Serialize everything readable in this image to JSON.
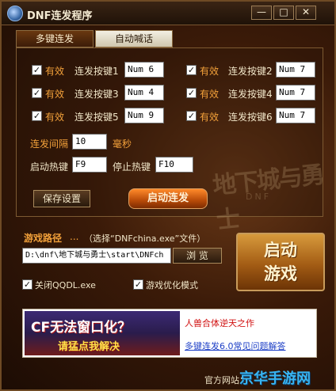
{
  "window": {
    "title": "DNF连发程序",
    "min_glyph": "—",
    "max_glyph": "□",
    "close_glyph": "✕"
  },
  "tabs": [
    {
      "label": "多键连发",
      "active": true
    },
    {
      "label": "自动喊话",
      "active": false
    }
  ],
  "keys": [
    {
      "enabled_label": "有效",
      "label": "连发按键1",
      "value": "Num 6",
      "checked": true
    },
    {
      "enabled_label": "有效",
      "label": "连发按键2",
      "value": "Num 7",
      "checked": true
    },
    {
      "enabled_label": "有效",
      "label": "连发按键3",
      "value": "Num 4",
      "checked": true
    },
    {
      "enabled_label": "有效",
      "label": "连发按键4",
      "value": "Num 7",
      "checked": true
    },
    {
      "enabled_label": "有效",
      "label": "连发按键5",
      "value": "Num 9",
      "checked": true
    },
    {
      "enabled_label": "有效",
      "label": "连发按键6",
      "value": "Num 7",
      "checked": true
    }
  ],
  "interval": {
    "label": "连发间隔",
    "value": "10",
    "unit": "毫秒"
  },
  "hotkeys": {
    "start_label": "启动热键",
    "start_value": "F9",
    "stop_label": "停止热键",
    "stop_value": "F10"
  },
  "buttons": {
    "save": "保存设置",
    "start": "启动连发",
    "browse": "浏 览",
    "launch_line1": "启动",
    "launch_line2": "游戏"
  },
  "game_path": {
    "label": "游戏路径",
    "dots": "...",
    "hint": "（选择“DNFchina.exe”文件）",
    "value": "D:\\dnf\\地下城与勇士\\start\\DNFch"
  },
  "options": [
    {
      "label": "关闭QQDL.exe",
      "checked": true
    },
    {
      "label": "游戏优化模式",
      "checked": true
    }
  ],
  "banner": {
    "line1": "CF无法窗口化？",
    "line2": "请猛点我解决",
    "link1": "人兽合体逆天之作",
    "link2": "多键连发6.0常见问题解答"
  },
  "watermark": {
    "text": "地下城与勇士",
    "sub": "DNF"
  },
  "footer": {
    "site_label": "官方网站：",
    "brand": "京华手游网"
  },
  "colors": {
    "accent_orange": "#f3a13a",
    "background": "#3a1a08",
    "link_red": "#d01010",
    "link_blue": "#1d3fc6"
  }
}
